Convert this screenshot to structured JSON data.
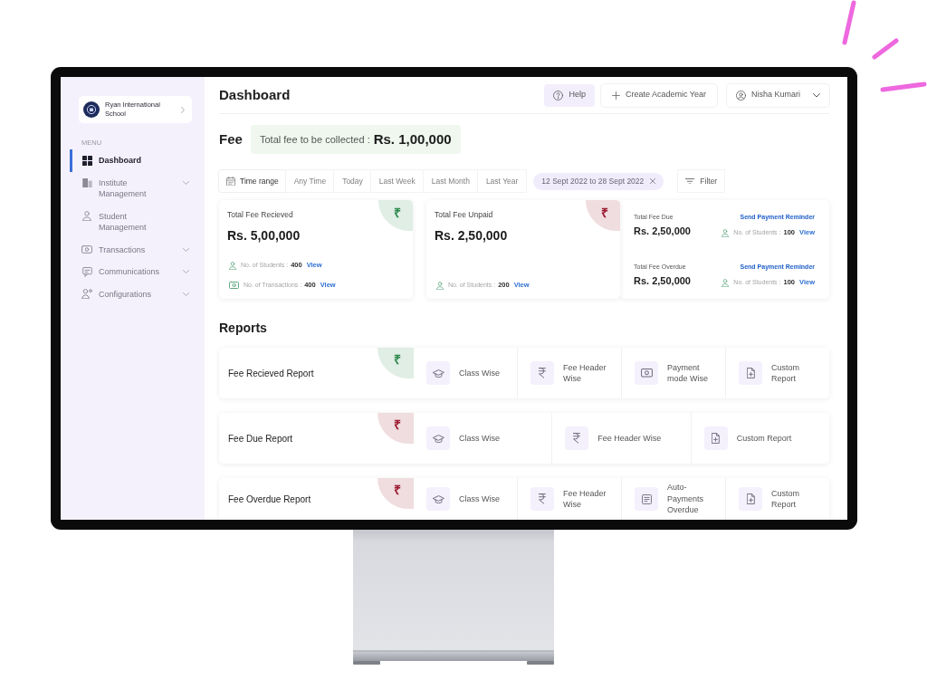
{
  "sidebar": {
    "school": {
      "name": "Ryan International School"
    },
    "menu_label": "MENU",
    "items": [
      {
        "label": "Dashboard",
        "kind": "link",
        "selected": true
      },
      {
        "label": "Institute Management",
        "kind": "group",
        "selected": false
      },
      {
        "label": "Student Management",
        "kind": "link",
        "selected": false
      },
      {
        "label": "Transactions",
        "kind": "group",
        "selected": false
      },
      {
        "label": "Communications",
        "kind": "group",
        "selected": false
      },
      {
        "label": "Configurations",
        "kind": "group",
        "selected": false
      }
    ]
  },
  "header": {
    "title": "Dashboard",
    "buttons": [
      {
        "kind": "help",
        "label": "Help"
      },
      {
        "kind": "create",
        "label": "Create Academic Year"
      }
    ],
    "user": {
      "name": "Nisha Kumari"
    }
  },
  "fee": {
    "title": "Fee",
    "total": {
      "label": "Total fee to be collected :",
      "value": "Rs. 1,00,000"
    },
    "time_filter": {
      "label": "Time range",
      "options": [
        {
          "label": "Any Time",
          "selected": false
        },
        {
          "label": "Today",
          "selected": false
        },
        {
          "label": "Last Week",
          "selected": false
        },
        {
          "label": "Last Month",
          "selected": false
        },
        {
          "label": "Last Year",
          "selected": false
        }
      ],
      "date_range": "12 Sept 2022 to 28 Sept 2022",
      "filter_label": "Filter"
    },
    "cards": [
      {
        "kind": "summary",
        "title": "Total Fee Recieved",
        "amount": "Rs. 5,00,000",
        "badge": {
          "symbol": "₹",
          "color": "#2e8b4e"
        },
        "stats": [
          {
            "kind": "students",
            "label": "No. of Students :",
            "value": "400",
            "link": "View"
          },
          {
            "kind": "transactions",
            "label": "No. of Transactions :",
            "value": "400",
            "link": "View"
          }
        ]
      },
      {
        "kind": "summary",
        "title": "Total Fee Unpaid",
        "amount": "Rs. 2,50,000",
        "badge": {
          "symbol": "₹",
          "color": "#9b1c31"
        },
        "stats": [
          {
            "kind": "students",
            "label": "No. of Students :",
            "value": "200",
            "link": "View"
          }
        ]
      },
      {
        "kind": "split",
        "sections": [
          {
            "title": "Total Fee Due",
            "amount": "Rs. 2,50,000",
            "action": "Send Payment Reminder",
            "stat": {
              "kind": "students",
              "label": "No. of Students :",
              "value": "100",
              "link": "View"
            }
          },
          {
            "title": "Total Fee Overdue",
            "amount": "Rs. 2,50,000",
            "action": "Send Payment Reminder",
            "stat": {
              "kind": "students",
              "label": "No. of Students :",
              "value": "100",
              "link": "View"
            }
          }
        ]
      }
    ]
  },
  "reports": {
    "title": "Reports",
    "rows": [
      {
        "title": "Fee Recieved Report",
        "badge": {
          "symbol": "₹",
          "color": "#2e8b4e"
        },
        "options": [
          {
            "kind": "class",
            "label": "Class Wise"
          },
          {
            "kind": "fee_header",
            "label": "Fee Header Wise"
          },
          {
            "kind": "payment_mode",
            "label": "Payment mode Wise"
          },
          {
            "kind": "custom",
            "label": "Custom Report"
          }
        ]
      },
      {
        "title": "Fee Due Report",
        "badge": {
          "symbol": "₹",
          "color": "#9b1c31"
        },
        "options": [
          {
            "kind": "class",
            "label": "Class Wise"
          },
          {
            "kind": "fee_header",
            "label": "Fee Header Wise"
          },
          {
            "kind": "custom",
            "label": "Custom Report"
          }
        ]
      },
      {
        "title": "Fee Overdue Report",
        "badge": {
          "symbol": "₹",
          "color": "#9b1c31"
        },
        "options": [
          {
            "kind": "class",
            "label": "Class Wise"
          },
          {
            "kind": "fee_header",
            "label": "Fee Header Wise"
          },
          {
            "kind": "auto_payments",
            "label": "Auto-Payments Overdue"
          },
          {
            "kind": "custom",
            "label": "Custom Report"
          }
        ]
      }
    ]
  }
}
